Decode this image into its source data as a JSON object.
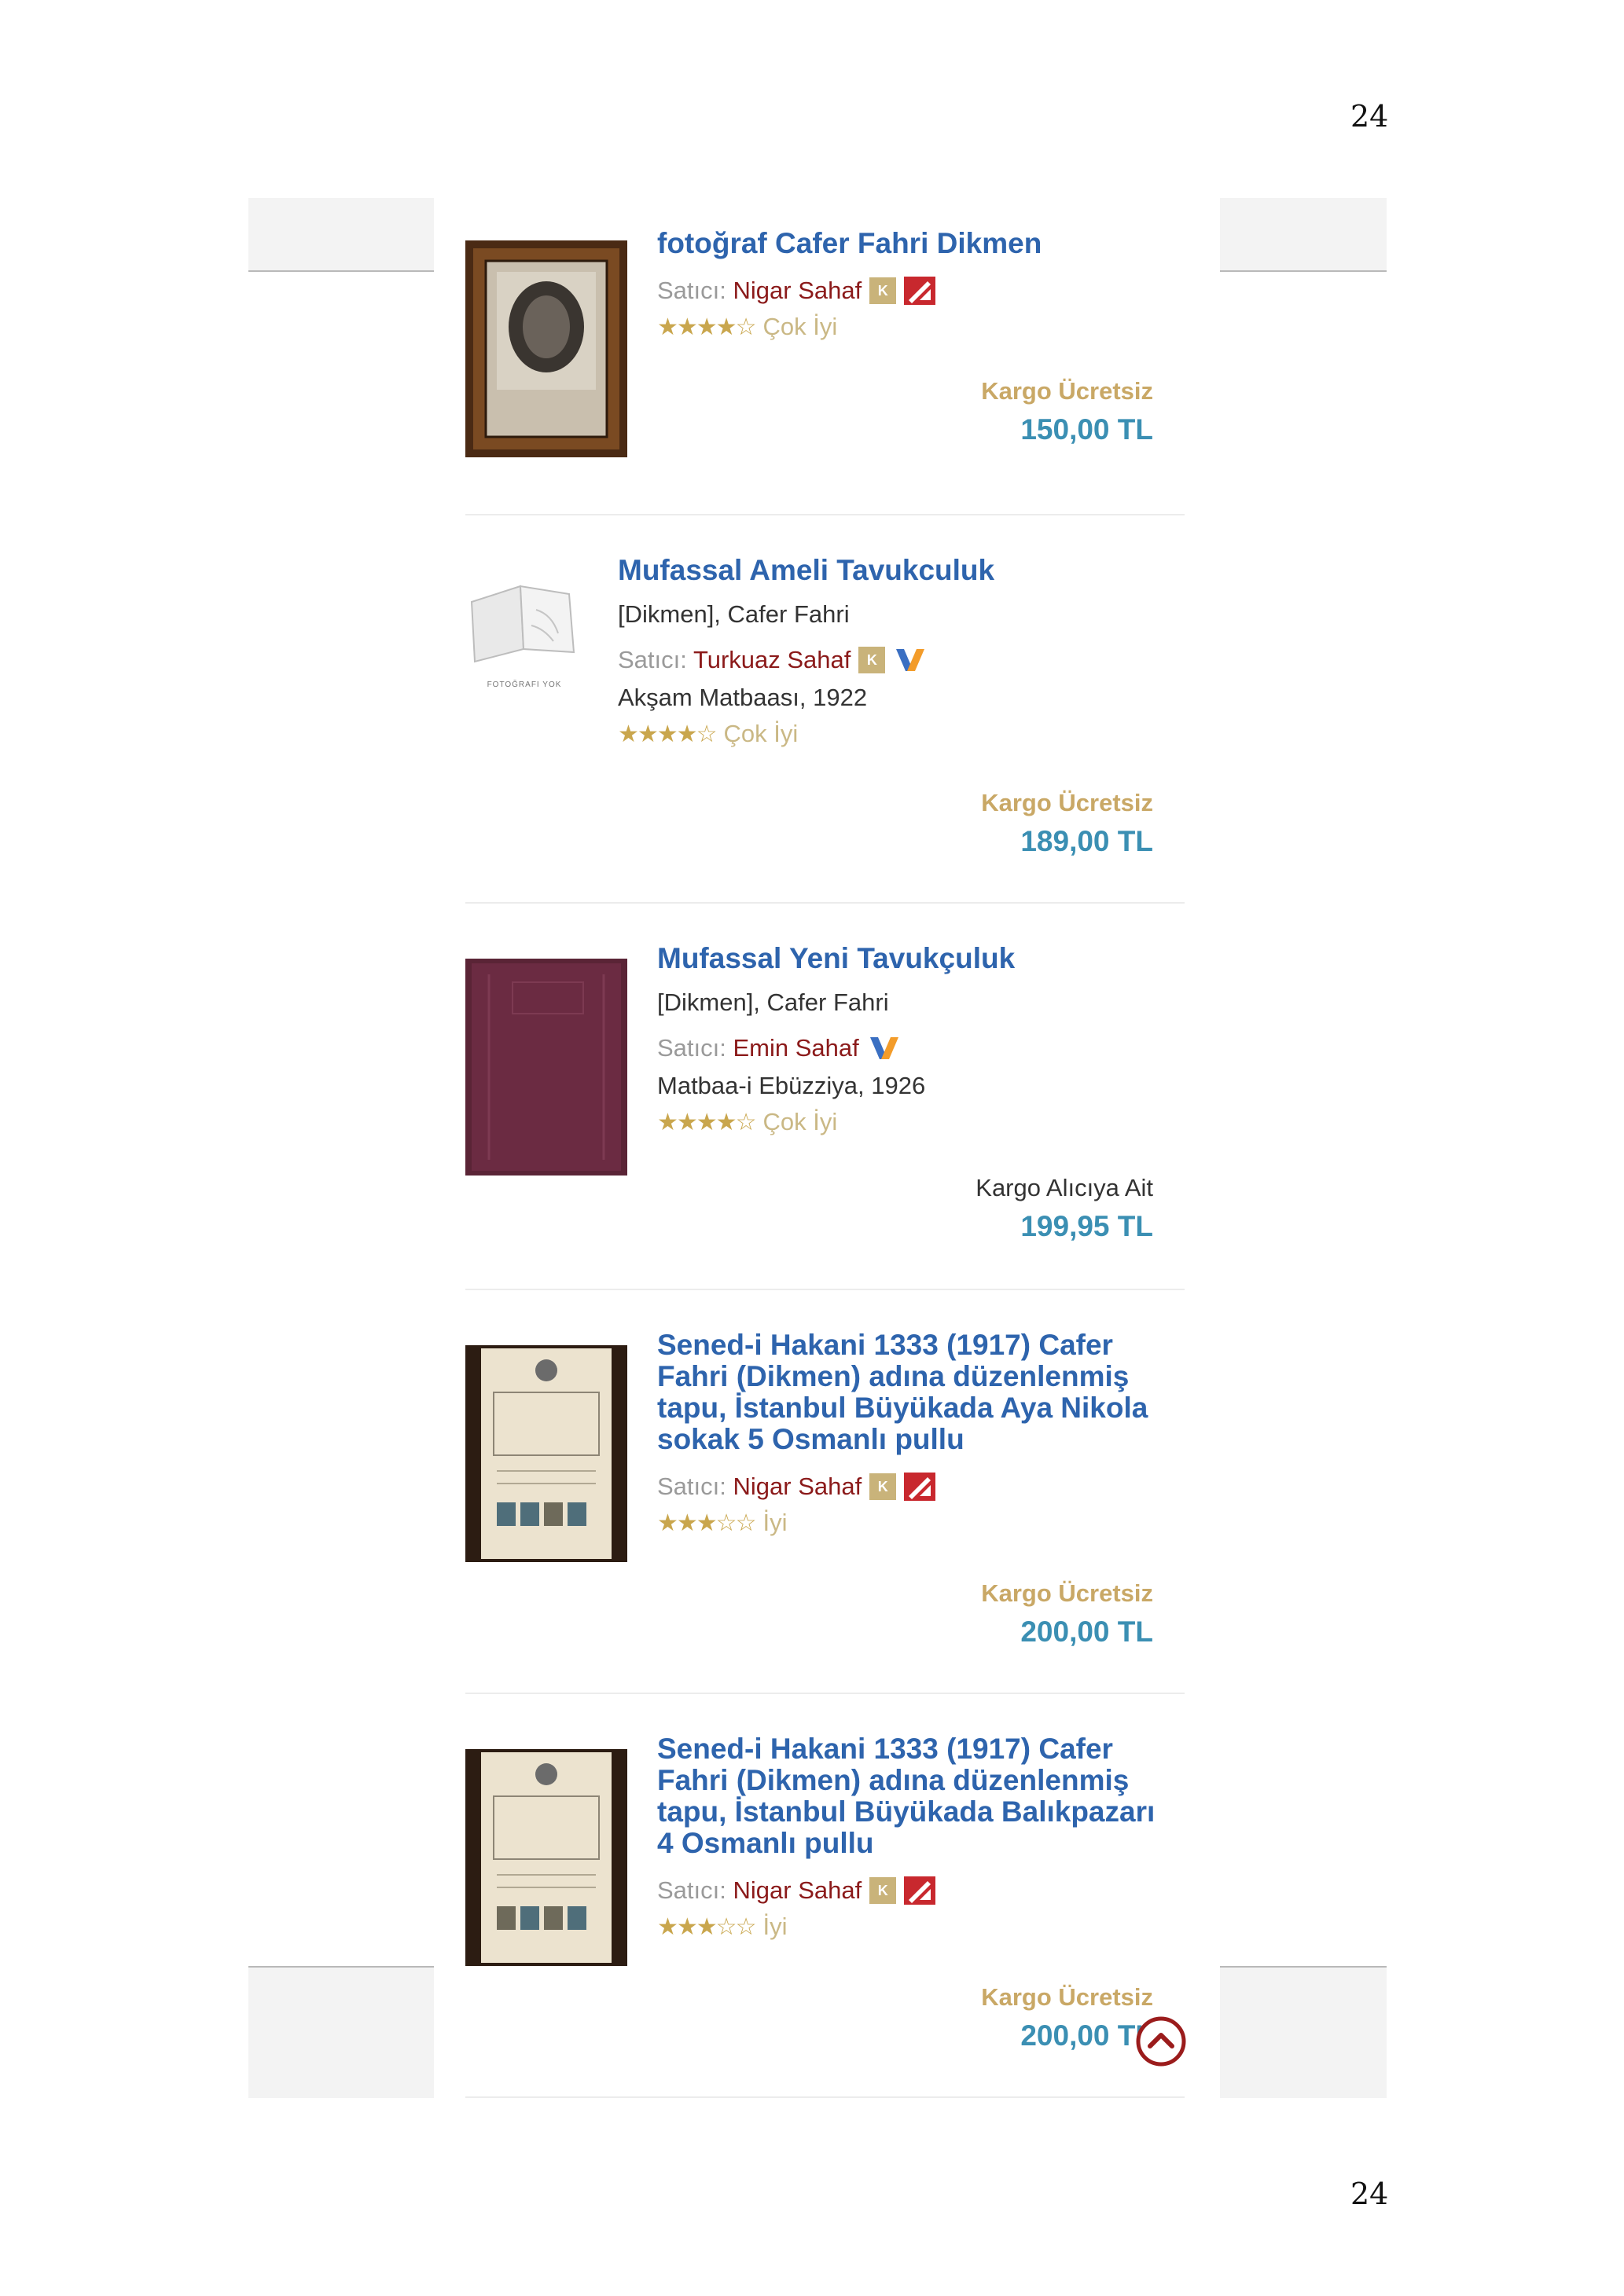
{
  "page": {
    "number_top": "24",
    "number_bottom": "24"
  },
  "listings": [
    {
      "title": "fotoğraf Cafer Fahri Dikmen",
      "author": "",
      "seller_label": "Satıcı:",
      "seller": "Nigar Sahaf",
      "badges": [
        "K",
        "red-ribbon-icon"
      ],
      "publisher": "",
      "stars_filled": 4,
      "stars_total": 5,
      "condition": "Çok İyi",
      "cargo": "Kargo Ücretsiz",
      "cargo_free": true,
      "price": "150,00 TL",
      "thumb": "framed-photograph"
    },
    {
      "title": "Mufassal Ameli Tavukculuk",
      "author": "[Dikmen], Cafer Fahri",
      "seller_label": "Satıcı:",
      "seller": "Turkuaz Sahaf",
      "badges": [
        "K",
        "x-logo-icon"
      ],
      "publisher": "Akşam Matbaası, 1922",
      "stars_filled": 4,
      "stars_total": 5,
      "condition": "Çok İyi",
      "cargo": "Kargo Ücretsiz",
      "cargo_free": true,
      "price": "189,00 TL",
      "thumb": "no-photo",
      "thumb_caption": "FOTOĞRAFI YOK"
    },
    {
      "title": "Mufassal Yeni Tavukçuluk",
      "author": "[Dikmen], Cafer Fahri",
      "seller_label": "Satıcı:",
      "seller": "Emin Sahaf",
      "badges": [
        "x-logo-icon"
      ],
      "publisher": "Matbaa-i Ebüzziya, 1926",
      "stars_filled": 4,
      "stars_total": 5,
      "condition": "Çok İyi",
      "cargo": "Kargo Alıcıya Ait",
      "cargo_free": false,
      "price": "199,95 TL",
      "thumb": "purple-book-cover"
    },
    {
      "title": "Sened-i Hakani 1333 (1917) Cafer Fahri (Dikmen) adına düzenlenmiş tapu, İstanbul Büyükada Aya Nikola sokak 5 Osmanlı pullu",
      "author": "",
      "seller_label": "Satıcı:",
      "seller": "Nigar Sahaf",
      "badges": [
        "K",
        "red-ribbon-icon"
      ],
      "publisher": "",
      "stars_filled": 3,
      "stars_total": 5,
      "condition": "İyi",
      "cargo": "Kargo Ücretsiz",
      "cargo_free": true,
      "price": "200,00 TL",
      "thumb": "deed-document"
    },
    {
      "title": "Sened-i Hakani 1333 (1917) Cafer Fahri (Dikmen) adına düzenlenmiş tapu, İstanbul Büyükada Balıkpazarı 4 Osmanlı pullu",
      "author": "",
      "seller_label": "Satıcı:",
      "seller": "Nigar Sahaf",
      "badges": [
        "K",
        "red-ribbon-icon"
      ],
      "publisher": "",
      "stars_filled": 3,
      "stars_total": 5,
      "condition": "İyi",
      "cargo": "Kargo Ücretsiz",
      "cargo_free": true,
      "price": "200,00 TL",
      "thumb": "deed-document"
    }
  ],
  "colors": {
    "title": "#2e64ad",
    "seller": "#8b1a1a",
    "cargo_free": "#c9a866",
    "price": "#3b8fb3",
    "stars": "#c9a64d",
    "scroll_button": "#9b1c1c"
  }
}
